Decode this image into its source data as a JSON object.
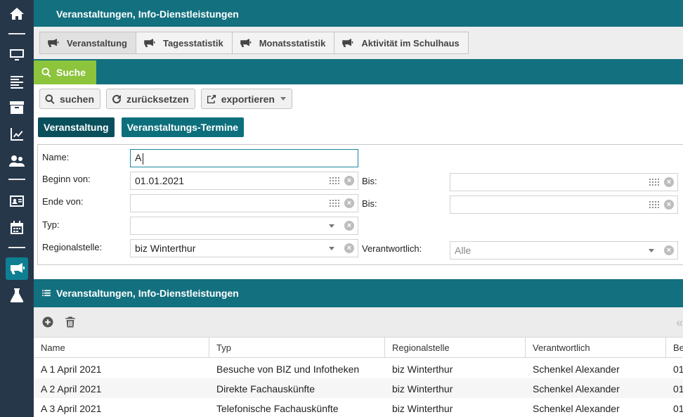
{
  "header": {
    "title": "Veranstaltungen, Info-Dienstleistungen"
  },
  "sidebar": {
    "icons": [
      "home-icon",
      "monitor-icon",
      "align-left-icon",
      "archive-icon",
      "chart-line-icon",
      "users-icon",
      "id-card-icon",
      "calendar-icon",
      "megaphone-icon",
      "flask-icon"
    ],
    "active": "megaphone-icon"
  },
  "tabs": [
    {
      "label": "Veranstaltung",
      "active": true
    },
    {
      "label": "Tagesstatistik",
      "active": false
    },
    {
      "label": "Monatsstatistik",
      "active": false
    },
    {
      "label": "Aktivität im Schulhaus",
      "active": false
    }
  ],
  "search": {
    "tab_label": "Suche",
    "buttons": {
      "search": "suchen",
      "reset": "zurücksetzen",
      "export": "exportieren"
    }
  },
  "subtabs": [
    {
      "label": "Veranstaltung"
    },
    {
      "label": "Veranstaltungs-Termine"
    }
  ],
  "form": {
    "name": {
      "label": "Name:",
      "value": "A"
    },
    "beginn": {
      "label": "Beginn von:",
      "value": "01.01.2021",
      "bis_label": "Bis:",
      "bis_value": ""
    },
    "ende": {
      "label": "Ende von:",
      "value": "",
      "bis_label": "Bis:",
      "bis_value": ""
    },
    "typ": {
      "label": "Typ:",
      "value": ""
    },
    "regionalstelle": {
      "label": "Regionalstelle:",
      "value": "biz Winterthur"
    },
    "verantwortlich": {
      "label": "Verantwortlich:",
      "value": "Alle"
    }
  },
  "list": {
    "title": "Veranstaltungen, Info-Dienstleistungen",
    "columns": [
      "Name",
      "Typ",
      "Regionalstelle",
      "Verantwortlich",
      "Be"
    ],
    "rows": [
      [
        "A 1 April 2021",
        "Besuche von BIZ und Infotheken",
        "biz Winterthur",
        "Schenkel Alexander",
        "01"
      ],
      [
        "A 2 April 2021",
        "Direkte Fachauskünfte",
        "biz Winterthur",
        "Schenkel Alexander",
        "01"
      ],
      [
        "A 3 April 2021",
        "Telefonische Fachauskünfte",
        "biz Winterthur",
        "Schenkel Alexander",
        "01"
      ]
    ]
  },
  "colors": {
    "teal": "#13707f",
    "sidebar": "#26374a",
    "search_tab": "#8cc43c",
    "subtab_dark": "#0a4f5c"
  }
}
